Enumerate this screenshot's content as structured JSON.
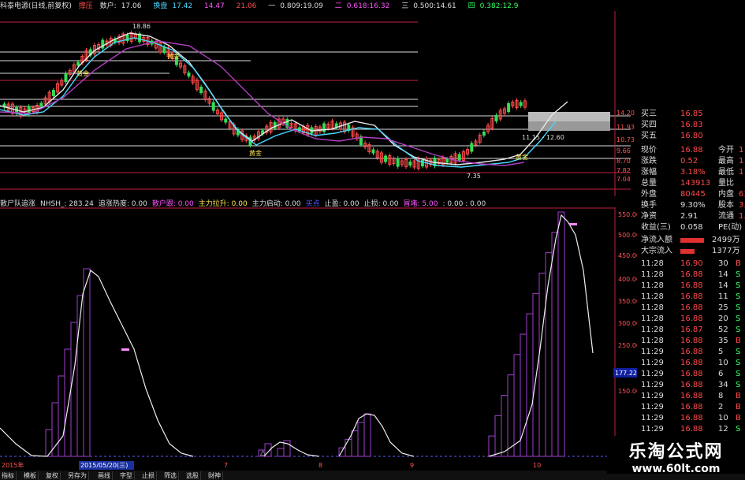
{
  "header": {
    "title": "科泰电源(日线,前复权)",
    "label2": "撑压",
    "items": [
      {
        "k": "数户:",
        "v": "17.06"
      },
      {
        "k": "",
        "v": "17.42"
      },
      {
        "k": "",
        "v": "14.47"
      },
      {
        "k": "",
        "v": "21.06"
      },
      {
        "k": "一",
        "v": "0.809:19.09"
      },
      {
        "k": "二",
        "v": "0.618:16.32"
      },
      {
        "k": "三",
        "v": "0.500:14.61"
      },
      {
        "k": "四",
        "v": "0.382:12.9"
      }
    ],
    "label_huan": "换盘"
  },
  "chart_top": {
    "ticks": [
      "14.20",
      "11.93",
      "10.73",
      "9.66",
      "8.70",
      "7.82",
      "7.04"
    ],
    "annotations": [
      "18.86",
      "黄金",
      "黄金",
      "黄金",
      "黄金",
      "11.15 - 12.60",
      "7.35"
    ]
  },
  "indicator_bar": [
    {
      "t": "散尸队追涨",
      "c": "#ddd"
    },
    {
      "t": "NHSH_: 283.24",
      "c": "#ddd"
    },
    {
      "t": "追涨热度: 0.00",
      "c": "#ddd"
    },
    {
      "t": "散户跟: 0.00",
      "c": "#ff55ff"
    },
    {
      "t": "主力拉升: 0.00",
      "c": "#ffe34d"
    },
    {
      "t": "主力启动: 0.00",
      "c": "#ddd"
    },
    {
      "t": "买点",
      "c": "#5a5aff"
    },
    {
      "t": "止盈: 0.00",
      "c": "#ddd"
    },
    {
      "t": "止损: 0.00",
      "c": "#ddd"
    },
    {
      "t": "冒堵: 5.00",
      "c": "#ff55ff"
    },
    {
      "t": ": 0.00 : 0.00",
      "c": "#ddd"
    }
  ],
  "chart_bottom": {
    "ticks": [
      "550.00",
      "500.00",
      "450.00",
      "400.00",
      "350.00",
      "300.00",
      "250.00",
      "200.00",
      "150.00"
    ],
    "marker": "177.22",
    "date_label": "2015/05/20(三)",
    "month_labels": [
      "7",
      "8",
      "9",
      "10"
    ],
    "year_label": "2015年"
  },
  "quote": {
    "asks": [
      {
        "k": "买三",
        "v": "16.85"
      },
      {
        "k": "买四",
        "v": "16.83"
      },
      {
        "k": "买五",
        "v": "16.80"
      }
    ],
    "stats": [
      {
        "k": "现价",
        "v": "16.88",
        "k2": "今开",
        "v2": "1"
      },
      {
        "k": "涨跌",
        "v": "0.52",
        "k2": "最高",
        "v2": "1"
      },
      {
        "k": "涨幅",
        "v": "3.18%",
        "k2": "最低",
        "v2": "1"
      },
      {
        "k": "总量",
        "v": "143913",
        "k2": "量比",
        "v2": ""
      },
      {
        "k": "外盘",
        "v": "80445",
        "k2": "内盘",
        "v2": "63"
      },
      {
        "k": "换手",
        "v": "9.30%",
        "k2": "股本",
        "v2": "3.2"
      },
      {
        "k": "净资",
        "v": "2.91",
        "k2": "流通",
        "v2": "1.5"
      },
      {
        "k": "收益(三)",
        "v": "0.058",
        "k2": "PE(动)",
        "v2": ""
      }
    ],
    "flows": [
      {
        "k": "净流入额",
        "v": "2499万"
      },
      {
        "k": "大宗流入",
        "v": "1377万"
      }
    ],
    "ticks": [
      {
        "t": "11:28",
        "p": "16.90",
        "n": "30",
        "s": "B"
      },
      {
        "t": "11:28",
        "p": "16.88",
        "n": "14",
        "s": "S"
      },
      {
        "t": "11:28",
        "p": "16.88",
        "n": "14",
        "s": "S"
      },
      {
        "t": "11:28",
        "p": "16.88",
        "n": "11",
        "s": "S"
      },
      {
        "t": "11:28",
        "p": "16.88",
        "n": "25",
        "s": "S"
      },
      {
        "t": "11:28",
        "p": "16.88",
        "n": "20",
        "s": "S"
      },
      {
        "t": "11:28",
        "p": "16.87",
        "n": "52",
        "s": "S"
      },
      {
        "t": "11:28",
        "p": "16.88",
        "n": "35",
        "s": "B"
      },
      {
        "t": "11:29",
        "p": "16.88",
        "n": "5",
        "s": "S"
      },
      {
        "t": "11:29",
        "p": "16.88",
        "n": "10",
        "s": "S"
      },
      {
        "t": "11:29",
        "p": "16.88",
        "n": "6",
        "s": "S"
      },
      {
        "t": "11:29",
        "p": "16.88",
        "n": "34",
        "s": "S"
      },
      {
        "t": "11:29",
        "p": "16.88",
        "n": "8",
        "s": "B"
      },
      {
        "t": "11:29",
        "p": "16.88",
        "n": "2",
        "s": "B"
      },
      {
        "t": "11:29",
        "p": "16.88",
        "n": "10",
        "s": "B"
      },
      {
        "t": "11:29",
        "p": "16.88",
        "n": "12",
        "s": "S"
      },
      {
        "t": "11:29",
        "p": "16.88",
        "n": "13",
        "s": "B"
      }
    ]
  },
  "bottom_tabs": [
    "指标",
    "模板",
    "复权",
    "另存为",
    "画线",
    "字型",
    "止损",
    "筛选",
    "选股",
    "财神"
  ],
  "watermark": {
    "cn": "乐淘公式网",
    "url": "www.60lt.com"
  }
}
